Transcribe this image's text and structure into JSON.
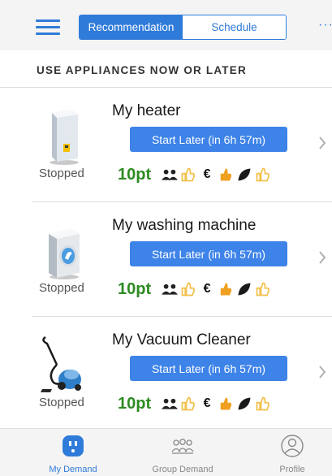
{
  "header": {
    "tabs": [
      {
        "label": "Recommendation",
        "active": true
      },
      {
        "label": "Schedule",
        "active": false
      }
    ],
    "more_label": "···"
  },
  "section": {
    "title": "USE APPLIANCES NOW OR LATER"
  },
  "appliances": [
    {
      "name": "My heater",
      "status": "Stopped",
      "action": "Start Later (in 6h 57m)",
      "points": "10pt",
      "euro": "€",
      "icon": "heater-icon"
    },
    {
      "name": "My washing machine",
      "status": "Stopped",
      "action": "Start Later (in 6h 57m)",
      "points": "10pt",
      "euro": "€",
      "icon": "washing-machine-icon"
    },
    {
      "name": "My Vacuum Cleaner",
      "status": "Stopped",
      "action": "Start Later (in 6h 57m)",
      "points": "10pt",
      "euro": "€",
      "icon": "vacuum-cleaner-icon"
    }
  ],
  "nav": [
    {
      "label": "My Demand",
      "active": true,
      "icon": "outlet-icon"
    },
    {
      "label": "Group Demand",
      "active": false,
      "icon": "group-icon"
    },
    {
      "label": "Profile",
      "active": false,
      "icon": "profile-icon"
    }
  ],
  "colors": {
    "accent": "#2f7bd9",
    "button": "#3d83e8",
    "points": "#2e8b22",
    "thumb_orange": "#f0a020",
    "thumb_outline": "#f2c04a"
  }
}
